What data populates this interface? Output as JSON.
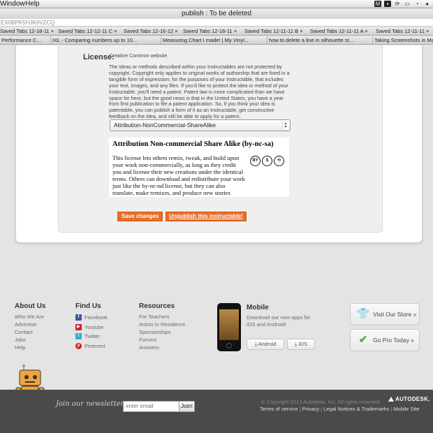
{
  "menubar": {
    "window": "Window",
    "help": "Help"
  },
  "window": {
    "title": "publish : To be deleted"
  },
  "url": "EX0BPK5HJK6VZCQ",
  "bookmarks_row1": [
    "Saved Tabs 12-18-11 ×",
    "Saved Tabs 12-12-11 C ×",
    "Saved Tabs 12-16-12 ×",
    "Saved Tabs 12-16-11 ×",
    "Saved Tabs 12-11-11 B ×",
    "Saved Tabs 12-11-11 A ×",
    "Saved Tabs 12-11-11 ×"
  ],
  "bookmarks_row2": [
    "Performance C...",
    "IXL - Comparing numbers up to 10...",
    "Measuring Chart I made! | My Vinyl...",
    "how to delete a line in silhouette st...",
    "Taking Screenshots in Ma"
  ],
  "license": {
    "label": "License:",
    "top_line": "Creative Common website.",
    "description": "The ideas or methods described within your Instructables are not protected by copyright. Copyright only applies to original works of authorship that are fixed in a tangible form of expression; for the purposes of your Instructable, that includes your text, images, and any files. If you'd like to protect the idea or method of your Instructable, you'll need a patent. Patent law is more complicated than we have space for here, but the good news is that in the United States, you have a year from first publication to file a patent application. So, if you think your idea is patentable, you can publish a form of it as an Instructable, get constructive feedback on the idea, and still be able to apply for a patent.",
    "selected": "Attribution-NonCommercial-ShareAlike",
    "box_title": "Attribution Non-commercial Share Alike (by-nc-sa)",
    "box_text": "This license lets others remix, tweak, and build upon your work non-commercially, as long as they credit you and license their new creations under the identical terms. Others can download and redistribute your work just like the by-nc-nd license, but they can also translate, make remixes, and produce new stories based on your work. All new",
    "cc_icons": [
      "BY",
      "$",
      "⟲"
    ]
  },
  "buttons": {
    "save": "Save changes",
    "unpublish": "Unpublish this instructable!"
  },
  "footer": {
    "about": {
      "title": "About Us",
      "links": [
        "Who We Are",
        "Advertise",
        "Contact",
        "Jobs",
        "Help"
      ]
    },
    "find": {
      "title": "Find Us",
      "links": [
        "Facebook",
        "Youtube",
        "Twitter",
        "Pinterest"
      ]
    },
    "resources": {
      "title": "Resources",
      "links": [
        "For Teachers",
        "Artists in Residence",
        "Sponsorships",
        "Forums",
        "Answers"
      ]
    },
    "mobile": {
      "title": "Mobile",
      "desc": "Download our new apps for iOS and Android!",
      "android": "Android",
      "ios": "iOS"
    },
    "store": "Visit Our Store »",
    "pro": "Go Pro Today »"
  },
  "bottom": {
    "newsletter": "Join our newsletter:",
    "email_placeholder": "enter email",
    "join": "Join!",
    "copyright": "© Copyright 2013 Autodesk, Inc. All rights reserved.",
    "autodesk": "AUTODESK.",
    "legal": [
      "Terms of service",
      "Privacy",
      "Legal Notices & Trademarks",
      "Mobile Site"
    ]
  },
  "colors": {
    "accent": "#e96e28",
    "footer_bg": "#4a4a4a",
    "facebook": "#3b5998",
    "youtube": "#cc2222",
    "twitter": "#33aadd",
    "pinterest": "#cb2027",
    "check": "#5aaa2a"
  }
}
